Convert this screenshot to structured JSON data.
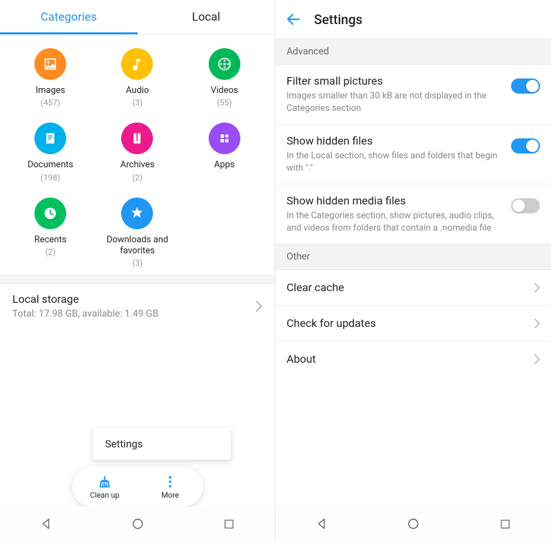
{
  "left": {
    "tabs": {
      "categories": "Categories",
      "local": "Local",
      "active": "categories"
    },
    "cats": [
      {
        "name": "images",
        "label": "Images",
        "count": "(457)",
        "color": "#ff8a1f"
      },
      {
        "name": "audio",
        "label": "Audio",
        "count": "(3)",
        "color": "#ffc107"
      },
      {
        "name": "videos",
        "label": "Videos",
        "count": "(55)",
        "color": "#00b857"
      },
      {
        "name": "documents",
        "label": "Documents",
        "count": "(198)",
        "color": "#00b0ec"
      },
      {
        "name": "archives",
        "label": "Archives",
        "count": "(2)",
        "color": "#ec1b8d"
      },
      {
        "name": "apps",
        "label": "Apps",
        "count": "",
        "color": "#9a4cf6"
      },
      {
        "name": "recents",
        "label": "Recents",
        "count": "(2)",
        "color": "#00bf5c"
      },
      {
        "name": "downloads",
        "label": "Downloads and favorites",
        "count": "(3)",
        "color": "#2196f3"
      }
    ],
    "storage": {
      "title": "Local storage",
      "sub": "Total: 17.98 GB, available: 1.49 GB"
    },
    "popup": {
      "settings": "Settings"
    },
    "pill": {
      "cleanup": "Clean up",
      "more": "More"
    }
  },
  "right": {
    "title": "Settings",
    "sections": {
      "advanced": {
        "header": "Advanced",
        "items": [
          {
            "label": "Filter small pictures",
            "desc": "Images smaller than 30 kB are not displayed in the Categories section",
            "on": true
          },
          {
            "label": "Show hidden files",
            "desc": "In the Local section, show files and folders that begin with \".\"",
            "on": true
          },
          {
            "label": "Show hidden media files",
            "desc": "In the Categories section, show pictures, audio clips, and videos from folders that contain a .nomedia file",
            "on": false
          }
        ]
      },
      "other": {
        "header": "Other",
        "items": [
          {
            "label": "Clear cache"
          },
          {
            "label": "Check for updates"
          },
          {
            "label": "About"
          }
        ]
      }
    }
  }
}
